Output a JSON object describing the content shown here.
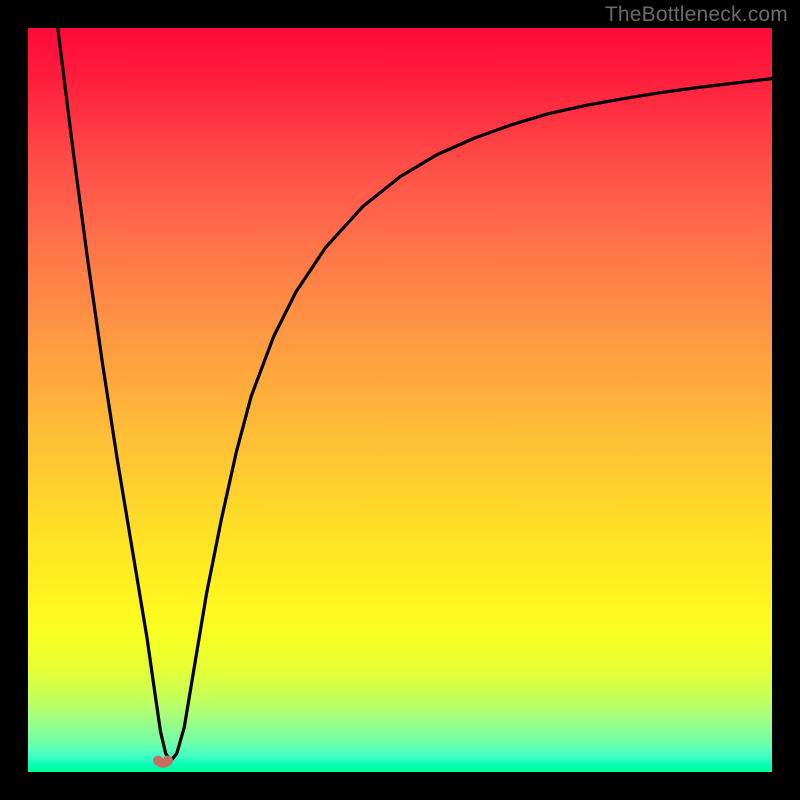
{
  "watermark": "TheBottleneck.com",
  "chart_data": {
    "type": "line",
    "title": "",
    "xlabel": "",
    "ylabel": "",
    "xlim": [
      0,
      100
    ],
    "ylim": [
      0,
      100
    ],
    "grid": false,
    "legend": false,
    "series": [
      {
        "name": "bottleneck-curve",
        "x": [
          4.0,
          6.0,
          8.0,
          10.0,
          12.0,
          14.0,
          16.0,
          17.0,
          17.8,
          18.5,
          19.2,
          20.0,
          21.0,
          22.0,
          24.0,
          26.0,
          28.0,
          30.0,
          33.0,
          36.0,
          40.0,
          45.0,
          50.0,
          55.0,
          60.0,
          65.0,
          70.0,
          75.0,
          80.0,
          85.0,
          90.0,
          95.0,
          100.0
        ],
        "values": [
          100.0,
          84.0,
          69.0,
          55.0,
          42.0,
          30.0,
          18.0,
          11.0,
          5.5,
          2.5,
          1.5,
          2.5,
          6.0,
          12.0,
          24.0,
          34.0,
          43.0,
          50.5,
          58.5,
          64.5,
          70.5,
          76.0,
          80.0,
          83.0,
          85.2,
          87.0,
          88.5,
          89.6,
          90.5,
          91.3,
          92.0,
          92.6,
          93.2
        ]
      }
    ],
    "marker": {
      "name": "optimal-point",
      "x": 18.2,
      "y": 1.3,
      "color": "#c96b5e"
    }
  }
}
